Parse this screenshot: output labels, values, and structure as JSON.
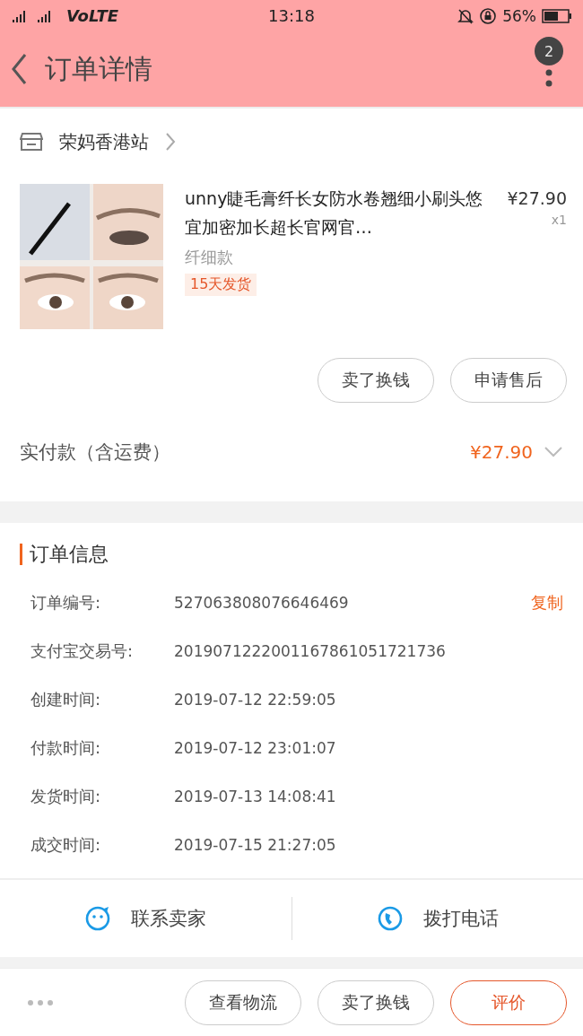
{
  "status_bar": {
    "network": "VoLTE",
    "time": "13:18",
    "battery": "56%"
  },
  "header": {
    "title": "订单详情",
    "badge": "2"
  },
  "store": {
    "name": "荣妈香港站"
  },
  "product": {
    "title": "unny睫毛膏纤长女防水卷翘细小刷头悠宜加密加长超长官网官…",
    "price": "¥27.90",
    "quantity": "x1",
    "variant": "纤细款",
    "tag": "15天发货"
  },
  "product_actions": [
    "卖了换钱",
    "申请售后"
  ],
  "payment": {
    "label": "实付款（含运费）",
    "amount": "¥27.90",
    "expanded": false
  },
  "order_info": {
    "title": "订单信息",
    "copy_label": "复制",
    "rows": [
      {
        "label": "订单编号:",
        "value": "527063808076646469"
      },
      {
        "label": "支付宝交易号:",
        "value": "2019071222001167861051721736"
      },
      {
        "label": "创建时间:",
        "value": "2019-07-12 22:59:05"
      },
      {
        "label": "付款时间:",
        "value": "2019-07-12 23:01:07"
      },
      {
        "label": "发货时间:",
        "value": "2019-07-13 14:08:41"
      },
      {
        "label": "成交时间:",
        "value": "2019-07-15 21:27:05"
      }
    ]
  },
  "contact": [
    {
      "kind": "chat",
      "label": "联系卖家"
    },
    {
      "kind": "phone",
      "label": "拨打电话"
    }
  ],
  "bottom_bar": {
    "buttons": [
      {
        "label": "查看物流",
        "primary": false
      },
      {
        "label": "卖了换钱",
        "primary": false
      },
      {
        "label": "评价",
        "primary": true
      }
    ]
  }
}
